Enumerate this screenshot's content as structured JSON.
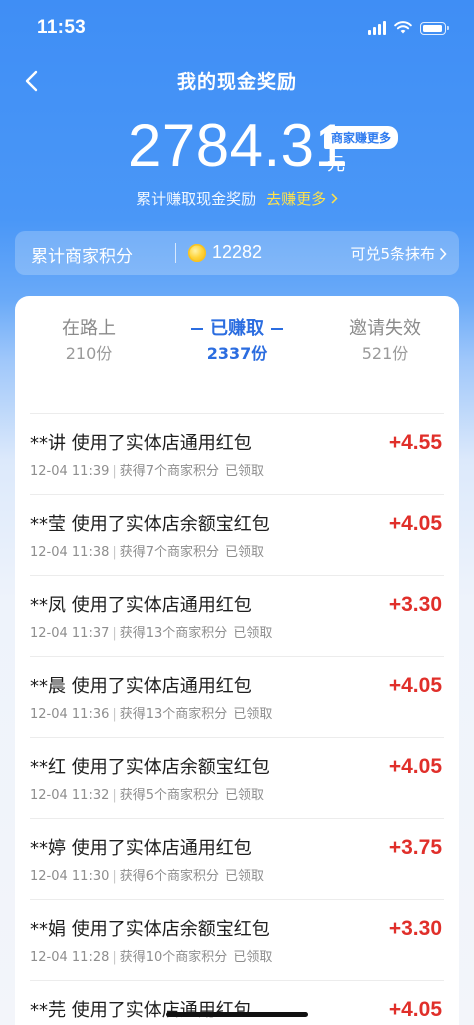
{
  "status_bar": {
    "time": "11:53"
  },
  "header": {
    "title": "我的现金奖励"
  },
  "summary": {
    "amount": "2784.31",
    "unit": "元",
    "badge": "商家赚更多",
    "caption": "累计赚取现金奖励",
    "link": "去赚更多"
  },
  "points": {
    "label": "累计商家积分",
    "value": "12282",
    "redeem": "可兑5条抹布"
  },
  "tabs": [
    {
      "name": "在路上",
      "count": "210份"
    },
    {
      "name": "已赚取",
      "count": "2337份"
    },
    {
      "name": "邀请失效",
      "count": "521份"
    }
  ],
  "records": [
    {
      "title": "**讲  使用了实体店通用红包",
      "time": "12-04 11:39",
      "desc": "获得7个商家积分",
      "status": "已领取",
      "amount": "+4.55"
    },
    {
      "title": "**莹  使用了实体店余额宝红包",
      "time": "12-04 11:38",
      "desc": "获得7个商家积分",
      "status": "已领取",
      "amount": "+4.05"
    },
    {
      "title": "**凤  使用了实体店通用红包",
      "time": "12-04 11:37",
      "desc": "获得13个商家积分",
      "status": "已领取",
      "amount": "+3.30"
    },
    {
      "title": "**晨  使用了实体店通用红包",
      "time": "12-04 11:36",
      "desc": "获得13个商家积分",
      "status": "已领取",
      "amount": "+4.05"
    },
    {
      "title": "**红  使用了实体店余额宝红包",
      "time": "12-04 11:32",
      "desc": "获得5个商家积分",
      "status": "已领取",
      "amount": "+4.05"
    },
    {
      "title": "**婷  使用了实体店通用红包",
      "time": "12-04 11:30",
      "desc": "获得6个商家积分",
      "status": "已领取",
      "amount": "+3.75"
    },
    {
      "title": "**娟  使用了实体店余额宝红包",
      "time": "12-04 11:28",
      "desc": "获得10个商家积分",
      "status": "已领取",
      "amount": "+3.30"
    },
    {
      "title": "**芫  使用了实体店通用红包",
      "time": "",
      "desc": "",
      "status": "",
      "amount": "+4.05"
    }
  ],
  "colors": {
    "accent": "#2b6de0",
    "amount_red": "#e02f2a",
    "link_yellow": "#ffe24a"
  },
  "icons": {
    "back": "chevron-left-icon",
    "coin": "coin-icon",
    "redeem_arrow": "chevron-right-icon"
  }
}
